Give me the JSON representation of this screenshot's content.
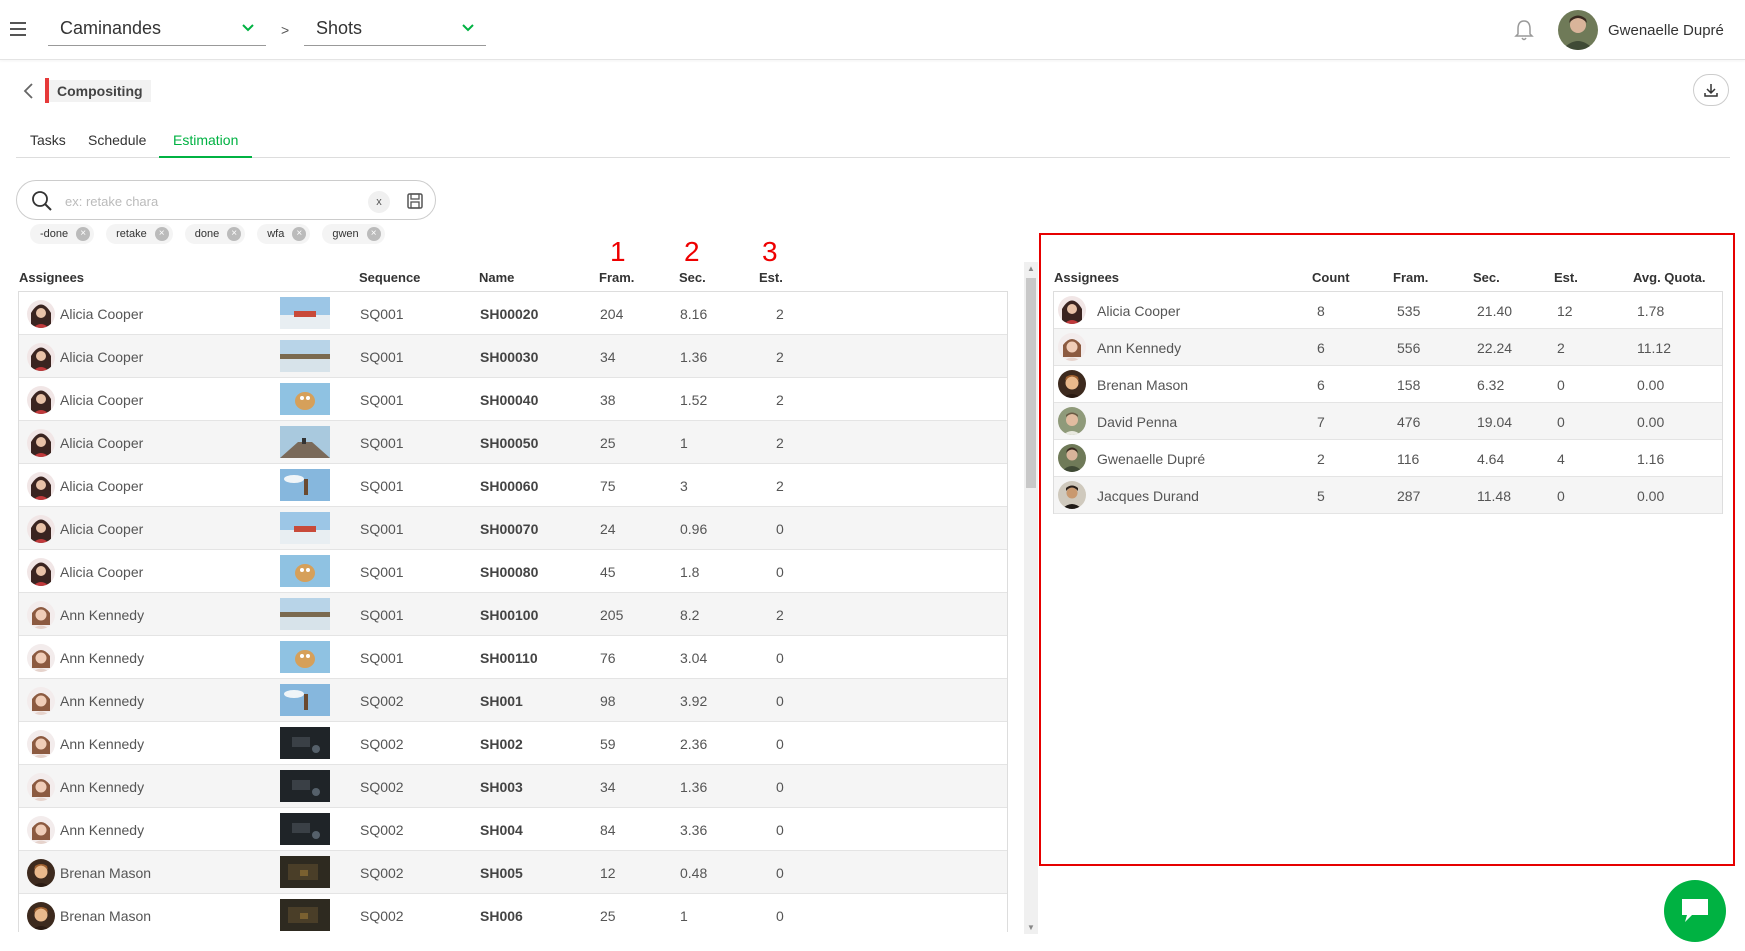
{
  "topbar": {
    "production": "Caminandes",
    "separator": ">",
    "section": "Shots",
    "user_name": "Gwenaelle Dupré"
  },
  "header": {
    "task_type": "Compositing"
  },
  "tabs": [
    {
      "label": "Tasks"
    },
    {
      "label": "Schedule"
    },
    {
      "label": "Estimation",
      "active": true
    }
  ],
  "search": {
    "placeholder": "ex: retake chara",
    "clear_label": "x",
    "value": ""
  },
  "filter_chips": [
    {
      "label": "-done"
    },
    {
      "label": "retake"
    },
    {
      "label": "done"
    },
    {
      "label": "wfa"
    },
    {
      "label": "gwen"
    }
  ],
  "annotations": [
    "1",
    "2",
    "3"
  ],
  "main_table": {
    "columns": [
      "Assignees",
      "Sequence",
      "Name",
      "Fram.",
      "Sec.",
      "Est."
    ],
    "rows": [
      {
        "assignee": "Alicia Cooper",
        "sequence": "SQ001",
        "name": "SH00020",
        "frames": "204",
        "seconds": "8.16",
        "estimation": "2",
        "thumb": "snow"
      },
      {
        "assignee": "Alicia Cooper",
        "sequence": "SQ001",
        "name": "SH00030",
        "frames": "34",
        "seconds": "1.36",
        "estimation": "2",
        "thumb": "cliff"
      },
      {
        "assignee": "Alicia Cooper",
        "sequence": "SQ001",
        "name": "SH00040",
        "frames": "38",
        "seconds": "1.52",
        "estimation": "2",
        "thumb": "llama"
      },
      {
        "assignee": "Alicia Cooper",
        "sequence": "SQ001",
        "name": "SH00050",
        "frames": "25",
        "seconds": "1",
        "estimation": "2",
        "thumb": "road"
      },
      {
        "assignee": "Alicia Cooper",
        "sequence": "SQ001",
        "name": "SH00060",
        "frames": "75",
        "seconds": "3",
        "estimation": "2",
        "thumb": "sky"
      },
      {
        "assignee": "Alicia Cooper",
        "sequence": "SQ001",
        "name": "SH00070",
        "frames": "24",
        "seconds": "0.96",
        "estimation": "0",
        "thumb": "snow"
      },
      {
        "assignee": "Alicia Cooper",
        "sequence": "SQ001",
        "name": "SH00080",
        "frames": "45",
        "seconds": "1.8",
        "estimation": "0",
        "thumb": "llama"
      },
      {
        "assignee": "Ann Kennedy",
        "sequence": "SQ001",
        "name": "SH00100",
        "frames": "205",
        "seconds": "8.2",
        "estimation": "2",
        "thumb": "cliff"
      },
      {
        "assignee": "Ann Kennedy",
        "sequence": "SQ001",
        "name": "SH00110",
        "frames": "76",
        "seconds": "3.04",
        "estimation": "0",
        "thumb": "llama"
      },
      {
        "assignee": "Ann Kennedy",
        "sequence": "SQ002",
        "name": "SH001",
        "frames": "98",
        "seconds": "3.92",
        "estimation": "0",
        "thumb": "sky"
      },
      {
        "assignee": "Ann Kennedy",
        "sequence": "SQ002",
        "name": "SH002",
        "frames": "59",
        "seconds": "2.36",
        "estimation": "0",
        "thumb": "dark"
      },
      {
        "assignee": "Ann Kennedy",
        "sequence": "SQ002",
        "name": "SH003",
        "frames": "34",
        "seconds": "1.36",
        "estimation": "0",
        "thumb": "dark"
      },
      {
        "assignee": "Ann Kennedy",
        "sequence": "SQ002",
        "name": "SH004",
        "frames": "84",
        "seconds": "3.36",
        "estimation": "0",
        "thumb": "dark"
      },
      {
        "assignee": "Brenan Mason",
        "sequence": "SQ002",
        "name": "SH005",
        "frames": "12",
        "seconds": "0.48",
        "estimation": "0",
        "thumb": "brown"
      },
      {
        "assignee": "Brenan Mason",
        "sequence": "SQ002",
        "name": "SH006",
        "frames": "25",
        "seconds": "1",
        "estimation": "0",
        "thumb": "brown"
      }
    ]
  },
  "summary_table": {
    "columns": [
      "Assignees",
      "Count",
      "Fram.",
      "Sec.",
      "Est.",
      "Avg. Quota."
    ],
    "rows": [
      {
        "assignee": "Alicia Cooper",
        "count": "8",
        "frames": "535",
        "seconds": "21.40",
        "estimation": "12",
        "avg_quota": "1.78"
      },
      {
        "assignee": "Ann Kennedy",
        "count": "6",
        "frames": "556",
        "seconds": "22.24",
        "estimation": "2",
        "avg_quota": "11.12"
      },
      {
        "assignee": "Brenan Mason",
        "count": "6",
        "frames": "158",
        "seconds": "6.32",
        "estimation": "0",
        "avg_quota": "0.00"
      },
      {
        "assignee": "David Penna",
        "count": "7",
        "frames": "476",
        "seconds": "19.04",
        "estimation": "0",
        "avg_quota": "0.00"
      },
      {
        "assignee": "Gwenaelle Dupré",
        "count": "2",
        "frames": "116",
        "seconds": "4.64",
        "estimation": "4",
        "avg_quota": "1.16"
      },
      {
        "assignee": "Jacques Durand",
        "count": "5",
        "frames": "287",
        "seconds": "11.48",
        "estimation": "0",
        "avg_quota": "0.00"
      }
    ]
  },
  "colors": {
    "accent": "#00b242",
    "highlight": "#e60000",
    "task_type": "#e63939"
  }
}
